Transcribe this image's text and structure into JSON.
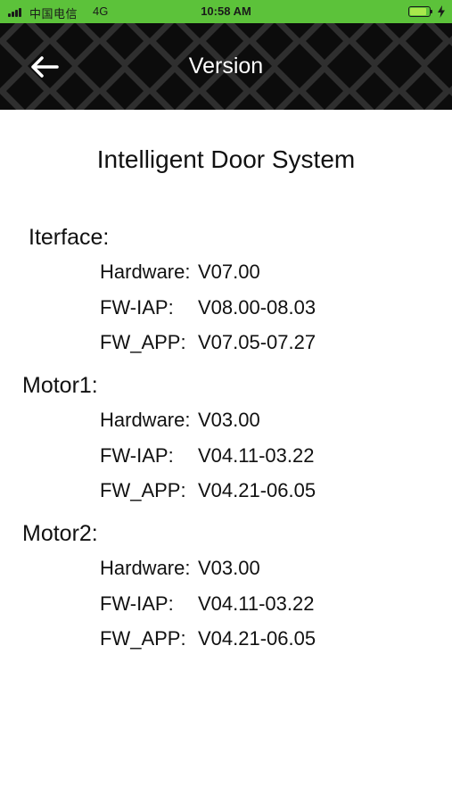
{
  "status_bar": {
    "carrier": "中国电信",
    "network": "4G",
    "time": "10:58 AM",
    "background_color": "#5cc23a"
  },
  "header": {
    "title": "Version",
    "back_icon": "arrow-left-icon",
    "background_color": "#0c0c0c"
  },
  "app_title": "Intelligent Door System",
  "sections": [
    {
      "label": "Iterface:",
      "rows": [
        {
          "key": "Hardware:",
          "value": "V07.00"
        },
        {
          "key": "FW-IAP:",
          "value": "V08.00-08.03"
        },
        {
          "key": "FW_APP:",
          "value": "V07.05-07.27"
        }
      ]
    },
    {
      "label": "Motor1:",
      "rows": [
        {
          "key": "Hardware:",
          "value": "V03.00"
        },
        {
          "key": "FW-IAP:",
          "value": "V04.11-03.22"
        },
        {
          "key": "FW_APP:",
          "value": "V04.21-06.05"
        }
      ]
    },
    {
      "label": "Motor2:",
      "rows": [
        {
          "key": "Hardware:",
          "value": "V03.00"
        },
        {
          "key": "FW-IAP:",
          "value": "V04.11-03.22"
        },
        {
          "key": "FW_APP:",
          "value": "V04.21-06.05"
        }
      ]
    }
  ]
}
